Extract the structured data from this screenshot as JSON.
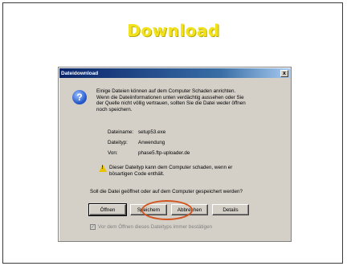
{
  "slide": {
    "title": "Download"
  },
  "dialog": {
    "title": "Dateidownload",
    "close_glyph": "x",
    "icon_glyph": "?",
    "intro_lines": [
      "Einige Dateien können auf dem Computer Schaden anrichten.",
      "Wenn die Dateiinformationen unten verdächtig aussehen oder Sie",
      "der Quelle nicht völlig vertrauen, sollten Sie die Datei weder öffnen",
      "noch speichern."
    ],
    "info": [
      {
        "label": "Dateiname:",
        "value": "setup53.exe"
      },
      {
        "label": "Dateityp:",
        "value": "Anwendung"
      },
      {
        "label": "Von:",
        "value": "phase5.ftp-uploader.de"
      }
    ],
    "warning_glyph": "!",
    "warning_lines": [
      "Dieser Dateityp kann dem Computer schaden, wenn er",
      "bösartigen Code enthält."
    ],
    "question": "Soll die Datei geöffnet oder auf dem Computer gespeichert werden?",
    "buttons": {
      "open": "Öffnen",
      "save": "Speichern",
      "cancel": "Abbrechen",
      "details": "Details"
    },
    "checkbox_glyph": "✓",
    "checkbox_label": "Vor dem Öffnen dieses Dateityps immer bestätigen"
  },
  "colors": {
    "title_yellow": "#f2e21c",
    "highlight_circle": "#d2541e",
    "titlebar_blue": "#0a246a"
  }
}
